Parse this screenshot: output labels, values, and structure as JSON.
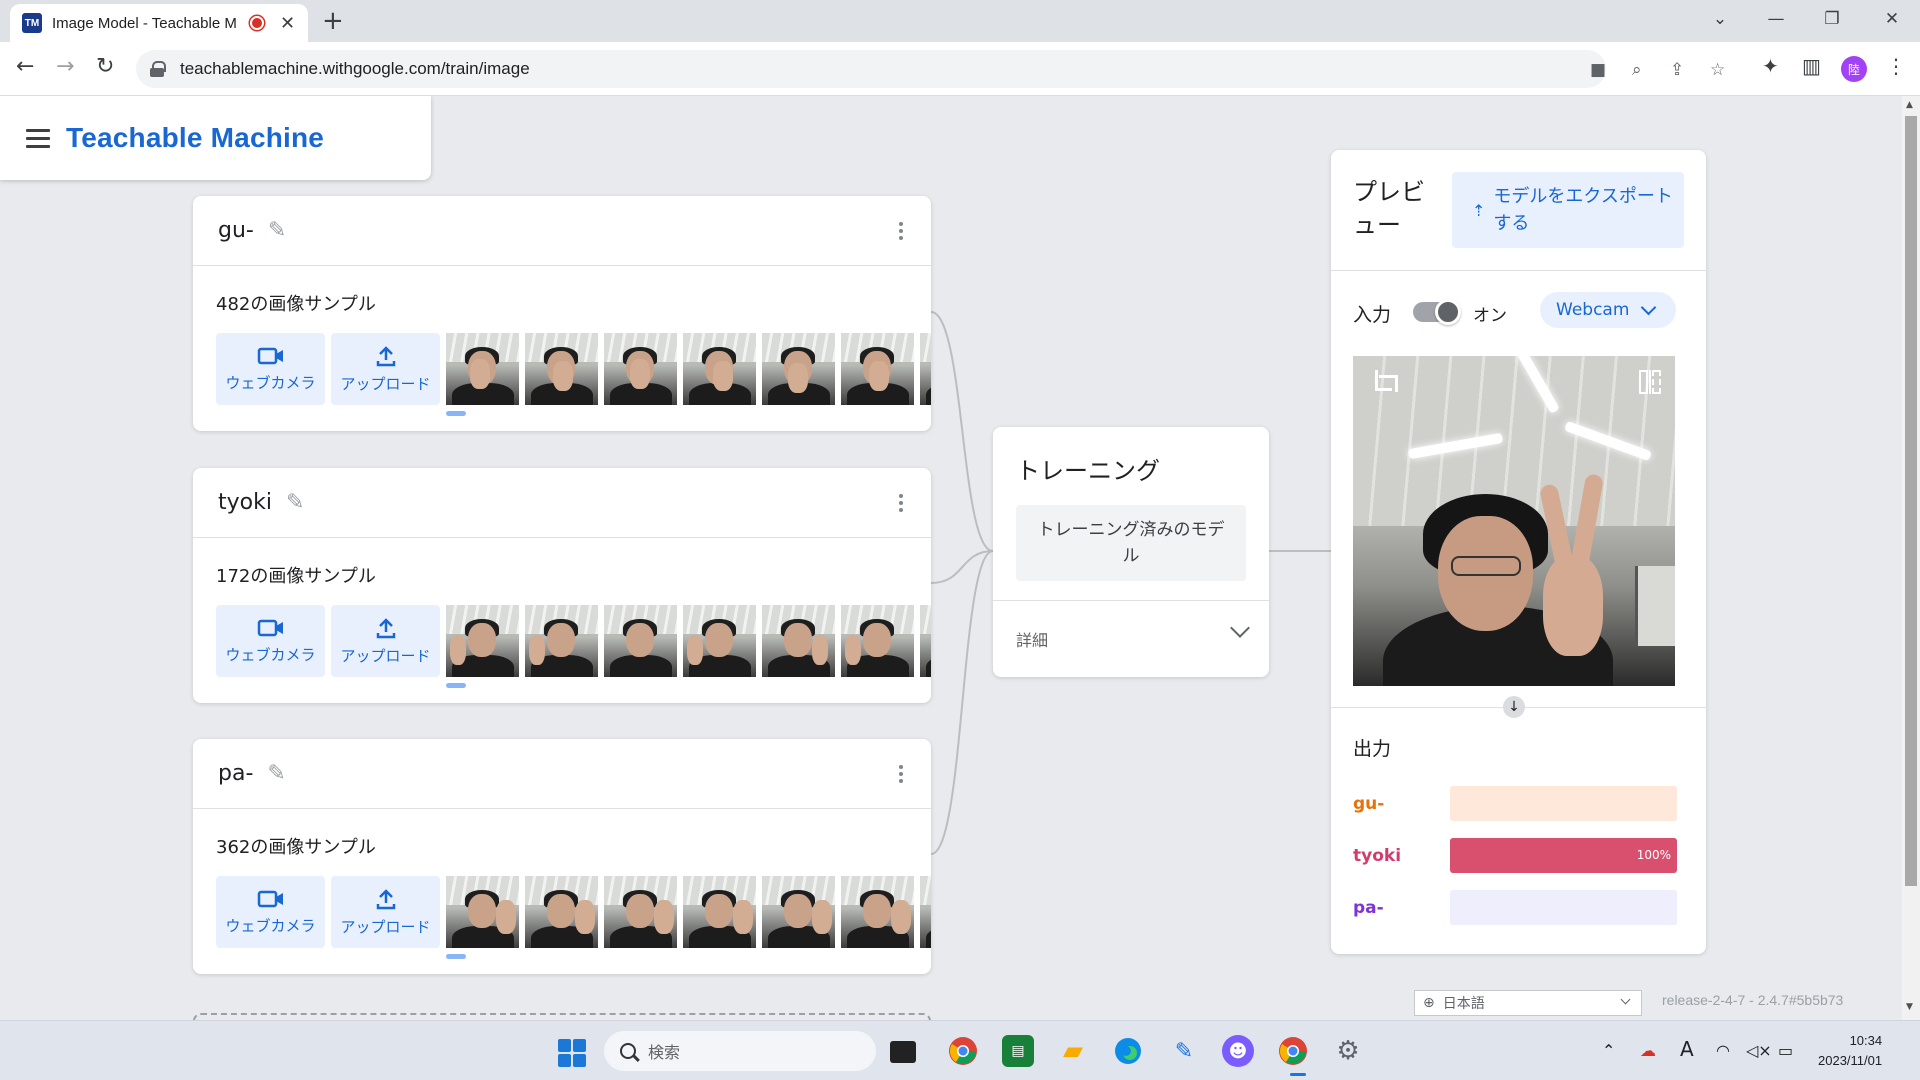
{
  "browser": {
    "tab_title": "Image Model - Teachable M",
    "tab_favicon_text": "TM",
    "url": "teachablemachine.withgoogle.com/train/image",
    "profile_initial": "陸"
  },
  "app": {
    "brand": "Teachable Machine"
  },
  "classes": [
    {
      "name": "gu-",
      "sample_count": "482の画像サンプル",
      "webcam_label": "ウェブカメラ",
      "upload_label": "アップロード"
    },
    {
      "name": "tyoki",
      "sample_count": "172の画像サンプル",
      "webcam_label": "ウェブカメラ",
      "upload_label": "アップロード"
    },
    {
      "name": "pa-",
      "sample_count": "362の画像サンプル",
      "webcam_label": "ウェブカメラ",
      "upload_label": "アップロード"
    }
  ],
  "training": {
    "title": "トレーニング",
    "button_label": "トレーニング済みのモデル",
    "advanced_label": "詳細"
  },
  "preview": {
    "title": "プレビュー",
    "export_label": "モデルをエクスポートする",
    "input_label": "入力",
    "toggle_state": "オン",
    "source_select": "Webcam",
    "output_label": "出力",
    "outputs": [
      {
        "label": "gu-",
        "value": 0,
        "pct_text": "",
        "color": "#e8710a",
        "bg": "#fde8d9"
      },
      {
        "label": "tyoki",
        "value": 100,
        "pct_text": "100%",
        "color": "#d33b6b",
        "bg": "#f9dbe4"
      },
      {
        "label": "pa-",
        "value": 0,
        "pct_text": "",
        "color": "#7e34d3",
        "bg": "#efeefd"
      }
    ]
  },
  "footer": {
    "language": "日本語",
    "release": "release-2-4-7 - 2.4.7#5b5b73"
  },
  "taskbar": {
    "search_placeholder": "検索",
    "time": "10:34",
    "date": "2023/11/01"
  },
  "colors": {
    "accent": "#1967d2",
    "accent_bg": "#e8f0fe",
    "page_bg": "#e8eaed"
  }
}
